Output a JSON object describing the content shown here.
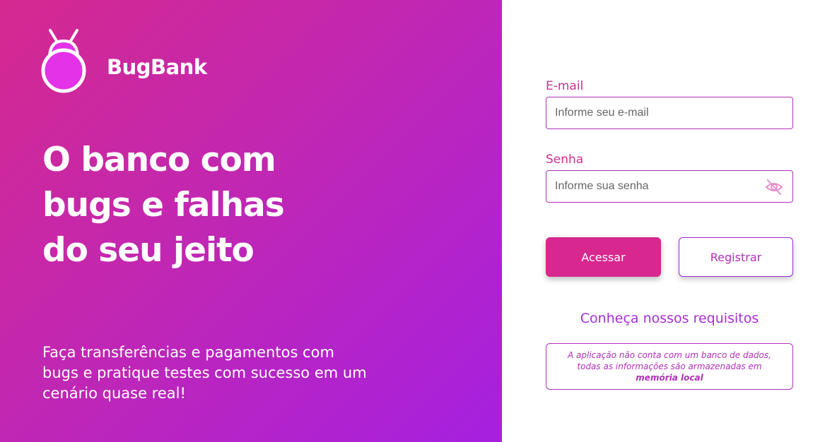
{
  "brand": {
    "name": "BugBank",
    "logo_icon": "bug-logo-icon"
  },
  "hero": {
    "headline_lines": [
      "O banco com",
      "bugs e falhas",
      "do seu jeito"
    ],
    "subtext": "Faça transferências e pagamentos com bugs e pratique testes com sucesso em um cenário quase real!"
  },
  "form": {
    "email_label": "E-mail",
    "email_placeholder": "Informe seu e-mail",
    "email_value": "",
    "password_label": "Senha",
    "password_placeholder": "Informe sua senha",
    "password_value": "",
    "password_toggle_icon": "eye-off-icon",
    "login_button": "Acessar",
    "register_button": "Registrar",
    "requirements_link": "Conheça nossos requisitos",
    "notice_text": "A aplicação não conta com um banco de dados, todas as informações são armazenadas em",
    "notice_bold": "memória local"
  },
  "colors": {
    "gradient_start": "#d5298f",
    "gradient_end": "#a520e0",
    "primary_button": "#d8278e",
    "accent": "#b02fb7"
  }
}
